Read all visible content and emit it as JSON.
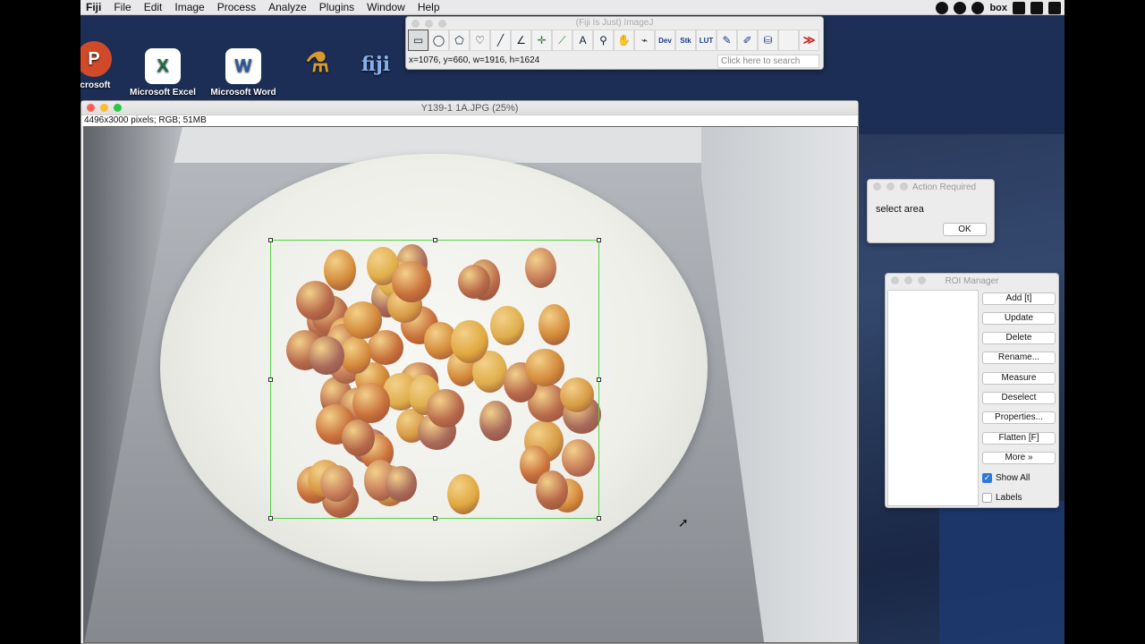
{
  "menubar": {
    "app_name": "Fiji",
    "items": [
      "File",
      "Edit",
      "Image",
      "Process",
      "Analyze",
      "Plugins",
      "Window",
      "Help"
    ],
    "status_text": "box"
  },
  "desktop": {
    "icons": [
      {
        "label": "icrosoft",
        "color": "#d04a2a",
        "glyph": "P"
      },
      {
        "label": "Microsoft Excel",
        "color": "#1d7044",
        "glyph": "X"
      },
      {
        "label": "Microsoft Word",
        "color": "#2b5aa5",
        "glyph": "W"
      },
      {
        "label": "ImageJ",
        "color": "#2a3558",
        "glyph": "🔬"
      },
      {
        "label": "Fiji",
        "color": "#2b4f86",
        "glyph": "Fiji"
      }
    ]
  },
  "imagej": {
    "title": "(Fiji Is Just) ImageJ",
    "status": "x=1076, y=660, w=1916, h=1624",
    "search_placeholder": "Click here to search",
    "tools": [
      {
        "name": "rectangle-tool-icon",
        "glyph": "▭"
      },
      {
        "name": "oval-tool-icon",
        "glyph": "◯"
      },
      {
        "name": "polygon-tool-icon",
        "glyph": "⬠"
      },
      {
        "name": "freehand-tool-icon",
        "glyph": "♡"
      },
      {
        "name": "line-tool-icon",
        "glyph": "╱"
      },
      {
        "name": "angle-tool-icon",
        "glyph": "∠"
      },
      {
        "name": "point-tool-icon",
        "glyph": "✛"
      },
      {
        "name": "wand-tool-icon",
        "glyph": "⟋"
      },
      {
        "name": "text-tool-icon",
        "glyph": "A"
      },
      {
        "name": "magnifier-tool-icon",
        "glyph": "⚲"
      },
      {
        "name": "hand-tool-icon",
        "glyph": "✋"
      },
      {
        "name": "dropper-tool-icon",
        "glyph": "⌁"
      },
      {
        "name": "dev-tool-icon",
        "glyph": "Dev"
      },
      {
        "name": "stk-tool-icon",
        "glyph": "Stk"
      },
      {
        "name": "lut-tool-icon",
        "glyph": "LUT"
      },
      {
        "name": "pencil-tool-icon",
        "glyph": "✎"
      },
      {
        "name": "brush-tool-icon",
        "glyph": "✐"
      },
      {
        "name": "flood-fill-tool-icon",
        "glyph": "⛁"
      },
      {
        "name": "blank-tool-icon",
        "glyph": ""
      },
      {
        "name": "more-tools-icon",
        "glyph": "≫"
      }
    ]
  },
  "image_window": {
    "title": "Y139-1 1A.JPG (25%)",
    "info": "4496x3000 pixels; RGB; 51MB"
  },
  "action_dialog": {
    "title": "Action Required",
    "message": "select area",
    "ok_label": "OK"
  },
  "roi_manager": {
    "title": "ROI Manager",
    "buttons": [
      "Add [t]",
      "Update",
      "Delete",
      "Rename...",
      "Measure",
      "Deselect",
      "Properties...",
      "Flatten [F]",
      "More »"
    ],
    "show_all_label": "Show All",
    "show_all_checked": true,
    "labels_label": "Labels",
    "labels_checked": false
  }
}
